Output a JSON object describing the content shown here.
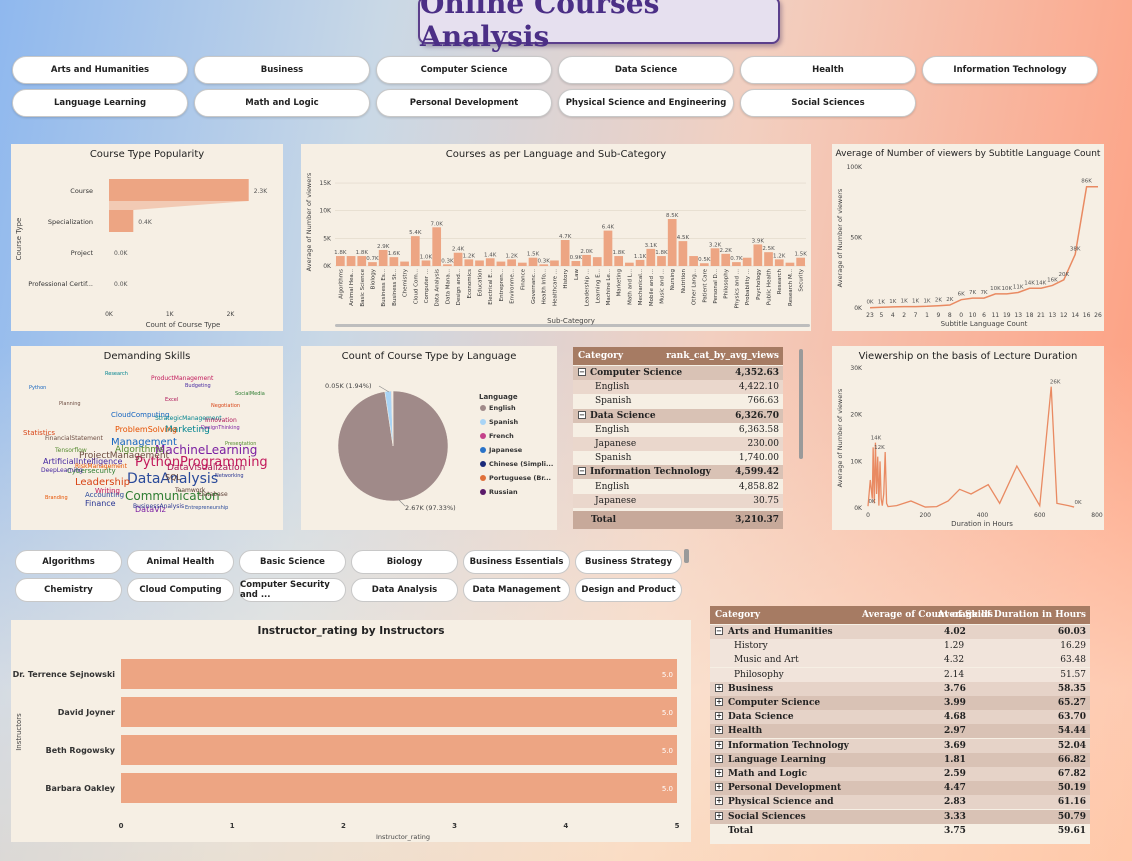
{
  "title": "Online Courses Analysis",
  "category_slicer": [
    "Arts and Humanities",
    "Business",
    "Computer Science",
    "Data Science",
    "Health",
    "Information Technology",
    "Language Learning",
    "Math and Logic",
    "Personal Development",
    "Physical Science and Engineering",
    "Social Sciences"
  ],
  "subcategory_slicer": [
    "Algorithms",
    "Animal Health",
    "Basic Science",
    "Biology",
    "Business Essentials",
    "Business Strategy",
    "Chemistry",
    "Cloud Computing",
    "Computer Security and ...",
    "Data Analysis",
    "Data Management",
    "Design and Product"
  ],
  "course_type_chart": {
    "title": "Course Type Popularity",
    "ylabel": "Course Type",
    "xlabel": "Count of Course Type",
    "chart_data": {
      "type": "bar",
      "categories": [
        "Course",
        "Specialization",
        "Project",
        "Professional Certif..."
      ],
      "values": [
        2.3,
        0.4,
        0.0,
        0.0
      ],
      "labels": [
        "2.3K",
        "0.4K",
        "0.0K",
        "0.0K"
      ],
      "xticks": [
        "0K",
        "1K",
        "2K"
      ],
      "xlim": [
        0,
        2.7
      ]
    }
  },
  "language_subcat_chart": {
    "title": "Courses as per Language and Sub-Category",
    "ylabel": "Average of Number of viewers",
    "xlabel": "Sub-Category",
    "chart_data": {
      "type": "bar",
      "ylim": [
        0,
        17
      ],
      "yticks": [
        "0K",
        "5K",
        "10K",
        "15K"
      ],
      "categories": [
        "Algorithms",
        "Animal Hea...",
        "Basic Science",
        "Biology",
        "Business Es...",
        "Business St...",
        "Chemistry",
        "Cloud Com...",
        "Computer ...",
        "Data Analysis",
        "Data Mana...",
        "Design and...",
        "Economics",
        "Education",
        "Electrical E...",
        "Entrepren...",
        "Environme...",
        "Finance",
        "Governanc...",
        "Health Info...",
        "Healthcare ...",
        "History",
        "Law",
        "Leadership ...",
        "Learning E...",
        "Machine Le...",
        "Marketing",
        "Math and L...",
        "Mechanical...",
        "Mobile and ...",
        "Music and ...",
        "Nursing",
        "Nutrition",
        "Other Lang...",
        "Patient Care",
        "Personal D...",
        "Philosophy",
        "Physics and ...",
        "Probability ...",
        "Psychology",
        "Public Health",
        "Research",
        "Research M...",
        "Security"
      ],
      "values": [
        1.8,
        1.8,
        1.8,
        0.7,
        2.9,
        1.6,
        0.8,
        5.4,
        1.0,
        7.0,
        0.3,
        2.4,
        1.2,
        1.0,
        1.4,
        0.8,
        1.2,
        0.6,
        1.5,
        0.3,
        1.0,
        4.7,
        0.9,
        2.0,
        1.6,
        6.4,
        1.8,
        0.6,
        1.1,
        3.1,
        1.8,
        8.5,
        4.5,
        1.8,
        0.5,
        3.2,
        2.2,
        0.7,
        1.5,
        3.9,
        2.5,
        1.2,
        0.6,
        1.5
      ],
      "labels": [
        "1.8K",
        "",
        "1.8K",
        "0.7K",
        "2.9K",
        "1.6K",
        "",
        "5.4K",
        "1.0K",
        "7.0K",
        "0.3K",
        "2.4K",
        "1.2K",
        "",
        "1.4K",
        "",
        "1.2K",
        "",
        "1.5K",
        "0.3K",
        "",
        "4.7K",
        "0.9K",
        "2.0K",
        "",
        "6.4K",
        "1.8K",
        "",
        "1.1K",
        "3.1K",
        "1.8K",
        "8.5K",
        "4.5K",
        "",
        "0.5K",
        "3.2K",
        "2.2K",
        "0.7K",
        "",
        "3.9K",
        "2.5K",
        "1.2K",
        "",
        "1.5K"
      ]
    }
  },
  "subtitle_chart": {
    "title": "Average of Number of viewers by Subtitle Language Count",
    "ylabel": "Average of Number of viewers",
    "xlabel": "Subtitle Language Count",
    "chart_data": {
      "type": "line",
      "x": [
        "23",
        "5",
        "4",
        "2",
        "7",
        "1",
        "9",
        "8",
        "0",
        "10",
        "6",
        "11",
        "19",
        "13",
        "18",
        "21",
        "13",
        "12",
        "14",
        "16",
        "26"
      ],
      "values": [
        0.2,
        0.5,
        0.8,
        1.0,
        1.0,
        1.2,
        1.6,
        2.1,
        5.9,
        7,
        7,
        10,
        10,
        11,
        14,
        14,
        16,
        20,
        38,
        86,
        86
      ],
      "labels": [
        "0K",
        "1K",
        "1K",
        "1K",
        "1K",
        "1K",
        "2K",
        "2K",
        "6K",
        "7K",
        "7K",
        "10K",
        "10K",
        "11K",
        "14K",
        "14K",
        "16K",
        "20K",
        "38K",
        "86K"
      ],
      "ylim": [
        0,
        100
      ],
      "yticks": [
        "0K",
        "50K",
        "100K"
      ]
    }
  },
  "skills_cloud": {
    "title": "Demanding Skills",
    "words": [
      "DataAnalysis",
      "PythonProgramming",
      "MachineLearning",
      "Communication",
      "Leadership",
      "Management",
      "ProjectManagement",
      "Marketing",
      "DataVisualization",
      "ArtificialIntelligence",
      "ProblemSolving",
      "Algorithms",
      "SQL",
      "Finance",
      "Accounting",
      "Writing",
      "DataViz",
      "Cybersecurity",
      "Statistics",
      "CloudComputing",
      "FinancialStatement",
      "StrategicManagement",
      "Innovation",
      "DeepLearning",
      "RiskManagement",
      "Tensorflow",
      "Database",
      "BusinessAnalysis",
      "Entrepreneurship",
      "ProductManagement",
      "DesignThinking",
      "SocialMedia",
      "Negotiation",
      "Python",
      "Planning",
      "Research",
      "Excel",
      "Budgeting",
      "Branding",
      "Presentation",
      "Teamwork",
      "Networking"
    ]
  },
  "pie_chart": {
    "title": "Count of Course Type by Language",
    "legend_title": "Language",
    "chart_data": {
      "type": "pie",
      "labels": [
        "English",
        "Spanish",
        "French",
        "Japanese",
        "Chinese (Simpli...",
        "Portuguese (Br...",
        "Russian"
      ],
      "values": [
        2670,
        52,
        4,
        3,
        2,
        2,
        2
      ],
      "colors": [
        "#a08a89",
        "#a9d4f5",
        "#c4418a",
        "#2a73c8",
        "#1a2a7a",
        "#e0703a",
        "#5a1a6a"
      ],
      "slice_labels": [
        "2.67K (97.33%)",
        "0.05K (1.94%)"
      ]
    }
  },
  "rank_table": {
    "headers": [
      "Category",
      "rank_cat_by_avg_views"
    ],
    "rows": [
      {
        "label": "Computer Science",
        "value": "4,352.63",
        "level": 0
      },
      {
        "label": "English",
        "value": "4,422.10",
        "level": 1
      },
      {
        "label": "Spanish",
        "value": "766.63",
        "level": 1
      },
      {
        "label": "Data Science",
        "value": "6,326.70",
        "level": 0
      },
      {
        "label": "English",
        "value": "6,363.58",
        "level": 1
      },
      {
        "label": "Japanese",
        "value": "230.00",
        "level": 1
      },
      {
        "label": "Spanish",
        "value": "1,740.00",
        "level": 1
      },
      {
        "label": "Information Technology",
        "value": "4,599.42",
        "level": 0
      },
      {
        "label": "English",
        "value": "4,858.82",
        "level": 1
      },
      {
        "label": "Japanese",
        "value": "30.75",
        "level": 1
      }
    ],
    "total_label": "Total",
    "total_value": "3,210.37"
  },
  "lecture_chart": {
    "title": "Viewership on the basis of Lecture Duration",
    "ylabel": "Average of Number of viewers",
    "xlabel": "Duration in Hours",
    "chart_data": {
      "type": "line",
      "x": [
        0,
        8,
        15,
        18,
        22,
        26,
        30,
        34,
        38,
        42,
        46,
        50,
        55,
        60,
        65,
        70,
        100,
        150,
        200,
        240,
        280,
        320,
        360,
        420,
        460,
        520,
        600,
        640,
        660,
        700,
        720
      ],
      "values": [
        0.4,
        6,
        2,
        13,
        1,
        14,
        3,
        11,
        0.5,
        10,
        2,
        0.5,
        3,
        12,
        1,
        0.3,
        0.5,
        1.5,
        0.2,
        0.3,
        1.5,
        4,
        3,
        5,
        1,
        9,
        0.5,
        26,
        1,
        0.5,
        0.2
      ],
      "labels": [
        "0K",
        "14K",
        "12K",
        "26K",
        "0K"
      ],
      "xlim": [
        0,
        800
      ],
      "ylim": [
        0,
        30
      ],
      "xticks": [
        "0",
        "200",
        "400",
        "600",
        "800"
      ],
      "yticks": [
        "0K",
        "10K",
        "20K",
        "30K"
      ]
    }
  },
  "instructor_chart": {
    "title": "Instructor_rating by Instructors",
    "ylabel": "Instructors",
    "xlabel": "Instructor_rating",
    "chart_data": {
      "type": "bar",
      "categories": [
        "Dr. Terrence Sejnowski",
        "David Joyner",
        "Beth Rogowsky",
        "Barbara Oakley"
      ],
      "values": [
        5.0,
        5.0,
        5.0,
        5.0
      ],
      "labels": [
        "5.0",
        "5.0",
        "5.0",
        "5.0"
      ],
      "xlim": [
        0,
        5
      ],
      "xticks": [
        "0",
        "1",
        "2",
        "3",
        "4",
        "5"
      ]
    }
  },
  "skills_table": {
    "headers": [
      "Category",
      "Average of Count of Skills",
      "Average of Duration in Hours"
    ],
    "rows": [
      {
        "label": "Arts and Humanities",
        "a": "4.02",
        "b": "60.03",
        "level": 0,
        "expanded": true
      },
      {
        "label": "History",
        "a": "1.29",
        "b": "16.29",
        "level": 1
      },
      {
        "label": "Music and Art",
        "a": "4.32",
        "b": "63.48",
        "level": 1
      },
      {
        "label": "Philosophy",
        "a": "2.14",
        "b": "51.57",
        "level": 1
      },
      {
        "label": "Business",
        "a": "3.76",
        "b": "58.35",
        "level": 0
      },
      {
        "label": "Computer Science",
        "a": "3.99",
        "b": "65.27",
        "level": 0
      },
      {
        "label": "Data Science",
        "a": "4.68",
        "b": "63.70",
        "level": 0
      },
      {
        "label": "Health",
        "a": "2.97",
        "b": "54.44",
        "level": 0
      },
      {
        "label": "Information Technology",
        "a": "3.69",
        "b": "52.04",
        "level": 0
      },
      {
        "label": "Language Learning",
        "a": "1.81",
        "b": "66.82",
        "level": 0
      },
      {
        "label": "Math and Logic",
        "a": "2.59",
        "b": "67.82",
        "level": 0
      },
      {
        "label": "Personal Development",
        "a": "4.47",
        "b": "50.19",
        "level": 0
      },
      {
        "label": "Physical Science and",
        "a": "2.83",
        "b": "61.16",
        "level": 0
      },
      {
        "label": "Social Sciences",
        "a": "3.33",
        "b": "50.79",
        "level": 0
      }
    ],
    "total_label": "Total",
    "total_a": "3.75",
    "total_b": "59.61"
  },
  "colors": {
    "bar": "#eda583",
    "bar_line": "#e98a62",
    "title_purple": "#4b2f86",
    "table_header": "#a67b63"
  }
}
